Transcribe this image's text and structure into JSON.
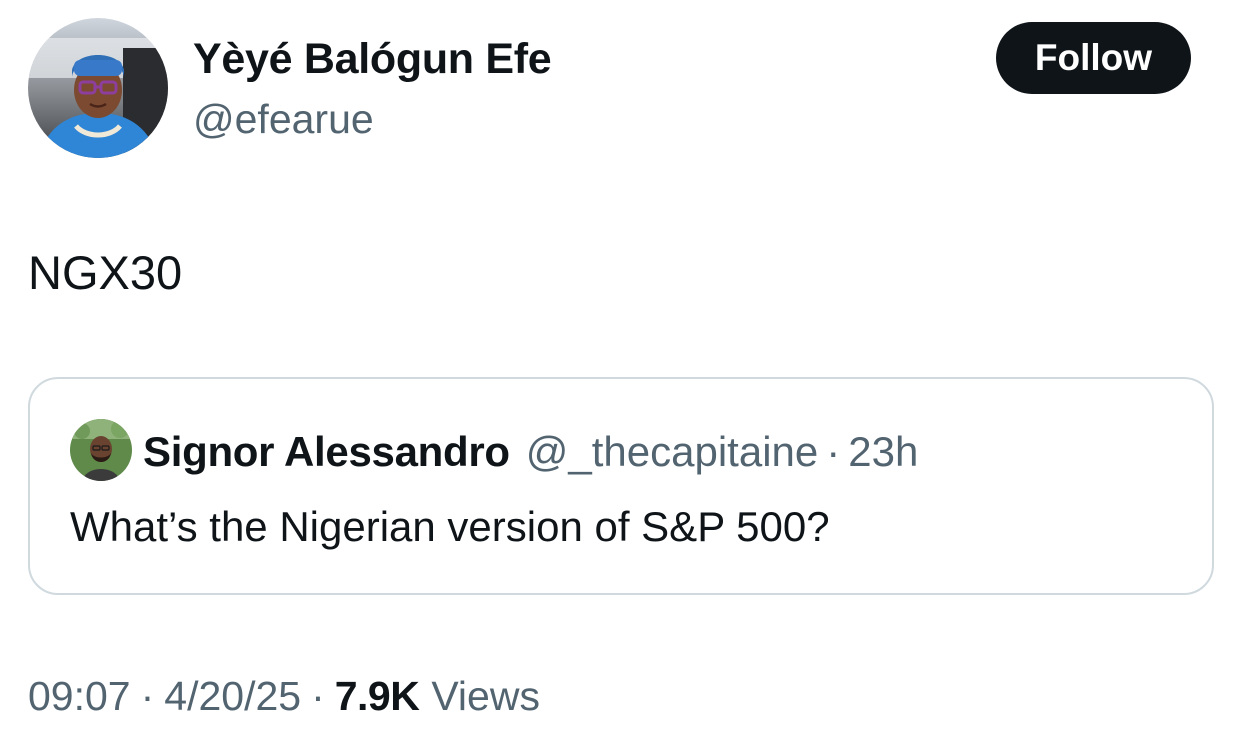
{
  "author": {
    "display_name": "Yèyé Balógun Efe",
    "handle": "@efearue",
    "avatar_icon": "profile-photo"
  },
  "follow_button": {
    "label": "Follow",
    "background": "#0f1419",
    "text_color": "#ffffff"
  },
  "tweet": {
    "text": "NGX30"
  },
  "quoted_tweet": {
    "display_name": "Signor Alessandro",
    "handle": "@_thecapitaine",
    "separator": "·",
    "time_ago": "23h",
    "text": "What’s the Nigerian version of S&P 500?",
    "avatar_icon": "profile-photo"
  },
  "meta": {
    "time": "09:07",
    "date": "4/20/25",
    "separator": "·",
    "views_count": "7.9K",
    "views_label": "Views"
  },
  "colors": {
    "primary_text": "#0f1419",
    "secondary_text": "#536471",
    "border": "#cfd9de"
  }
}
